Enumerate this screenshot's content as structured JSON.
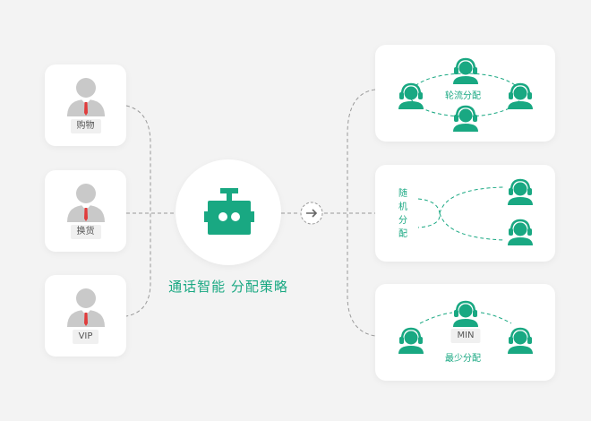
{
  "colors": {
    "accent": "#19a882",
    "user_gray": "#c9c9c9",
    "line": "#9a9a9a",
    "background": "#f3f3f3"
  },
  "users": [
    {
      "label": "购物",
      "icon": "user-avatar-icon"
    },
    {
      "label": "换货",
      "icon": "user-avatar-icon"
    },
    {
      "label": "VIP",
      "icon": "user-avatar-icon"
    }
  ],
  "center": {
    "icon": "robot-icon",
    "title": "通话智能 分配策略"
  },
  "connector": {
    "icon": "arrow-right-icon"
  },
  "strategies": [
    {
      "label": "轮流分配",
      "icon": "agent-headset-icon"
    },
    {
      "label": "随机分配",
      "icon": "agent-headset-icon"
    },
    {
      "label": "最少分配",
      "badge": "MIN",
      "icon": "agent-headset-icon"
    }
  ]
}
